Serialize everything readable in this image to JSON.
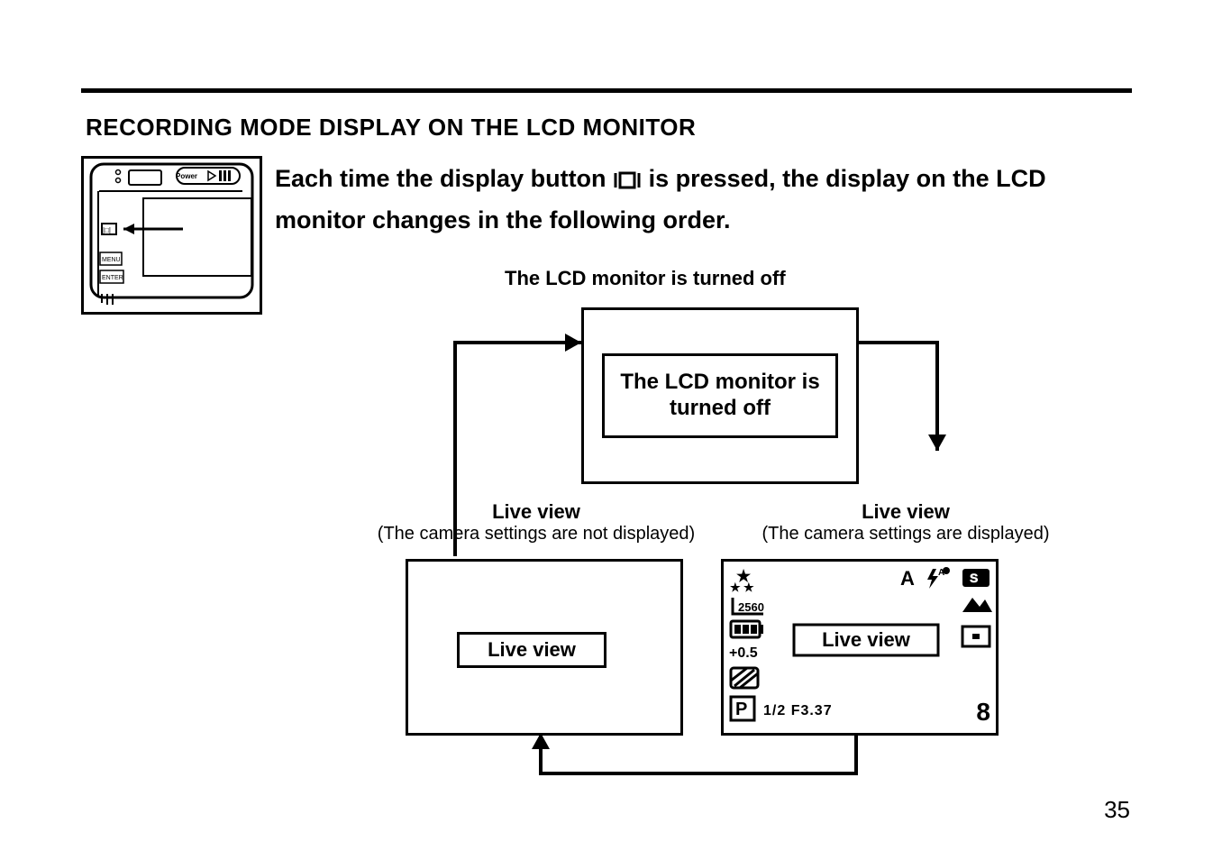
{
  "page_number": "35",
  "section_title": "RECORDING MODE DISPLAY ON THE LCD MONITOR",
  "intro_before": "Each time the display button ",
  "intro_after": " is pressed, the display on the LCD monitor changes in the following order.",
  "lcd_off_caption": "The LCD monitor is turned off",
  "state_off_text": "The LCD monitor is turned off",
  "live_left_bold": "Live view",
  "live_left_sub": "(The camera settings are not displayed)",
  "live_right_bold": "Live view",
  "live_right_sub": "(The camera settings are displayed)",
  "live_view_label": "Live view",
  "camera_labels": {
    "power": "Power",
    "menu": "MENU",
    "enter": "ENTER"
  },
  "lcd_overlay": {
    "resolution": "2560",
    "ev": "+0.5",
    "mode_letter": "A",
    "shutter_aperture": "1/2 F3.37",
    "remaining": "8",
    "program": "P"
  }
}
